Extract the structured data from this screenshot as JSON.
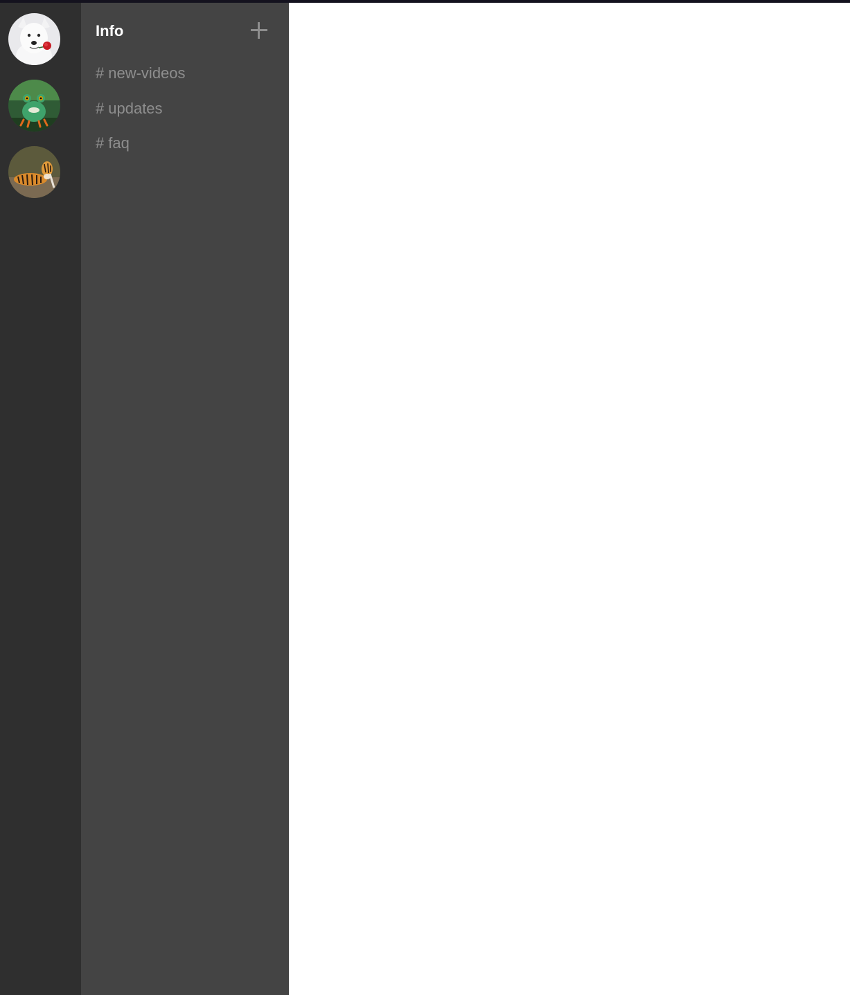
{
  "colors": {
    "server_rail_bg": "#2f2f2f",
    "channel_panel_bg": "#444444",
    "main_bg": "#ffffff",
    "title_color": "#ffffff",
    "channel_text_color": "#8e8e8e",
    "top_line": "#14121e"
  },
  "servers": [
    {
      "icon": "dog-with-rose-avatar"
    },
    {
      "icon": "frog-avatar"
    },
    {
      "icon": "tiger-avatar"
    }
  ],
  "channel_panel": {
    "title": "Info",
    "add_icon": "plus-icon",
    "hash_symbol": "#",
    "channels": [
      {
        "label": "new-videos"
      },
      {
        "label": "updates"
      },
      {
        "label": "faq"
      }
    ]
  }
}
